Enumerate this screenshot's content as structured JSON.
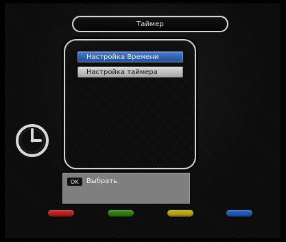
{
  "header": {
    "title": "Таймер"
  },
  "menu": {
    "items": [
      {
        "label": "Настройка Времени",
        "state": "selected"
      },
      {
        "label": "Настройка таймера",
        "state": "normal"
      }
    ]
  },
  "help": {
    "ok_label": "OK",
    "action_text": "Выбрать"
  },
  "icons": {
    "clock": "clock-icon"
  },
  "colors": {
    "selected_item": "#2f5fb0",
    "normal_item": "#bdbdbd",
    "help_bg": "#7f7f7f",
    "key_red": "#b32020",
    "key_green": "#2f7a12",
    "key_yellow": "#b7a118",
    "key_blue": "#1f58b8"
  }
}
